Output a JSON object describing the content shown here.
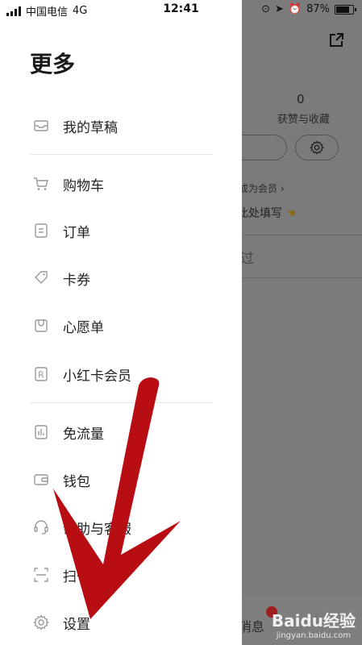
{
  "status_bar": {
    "carrier": "中国电信",
    "network": "4G",
    "time": "12:41",
    "battery": "87%",
    "battery_level": 0.87
  },
  "drawer": {
    "title": "更多",
    "items": [
      {
        "label": "我的草稿",
        "icon": "inbox-icon"
      },
      {
        "label": "购物车",
        "icon": "cart-icon"
      },
      {
        "label": "订单",
        "icon": "order-icon"
      },
      {
        "label": "卡券",
        "icon": "coupon-icon"
      },
      {
        "label": "心愿单",
        "icon": "wishlist-icon"
      },
      {
        "label": "小红卡会员",
        "icon": "member-card-icon"
      },
      {
        "label": "免流量",
        "icon": "free-data-icon"
      },
      {
        "label": "钱包",
        "icon": "wallet-icon"
      },
      {
        "label": "帮助与客服",
        "icon": "headset-icon"
      },
      {
        "label": "扫一扫",
        "icon": "scan-icon"
      },
      {
        "label": "设置",
        "icon": "settings-icon"
      }
    ]
  },
  "background": {
    "count": "0",
    "count_label": "获赞与收藏",
    "member_link": "成为会员",
    "fill_hint": "此处填写",
    "tab_text": "过",
    "bottom_tab": "消息"
  },
  "watermark": {
    "brand": "Baidu经验",
    "url": "jingyan.baidu.com"
  },
  "colors": {
    "overlay": "#7b7b7b",
    "drawer_bg": "#ffffff",
    "arrow": "#b80d12"
  }
}
